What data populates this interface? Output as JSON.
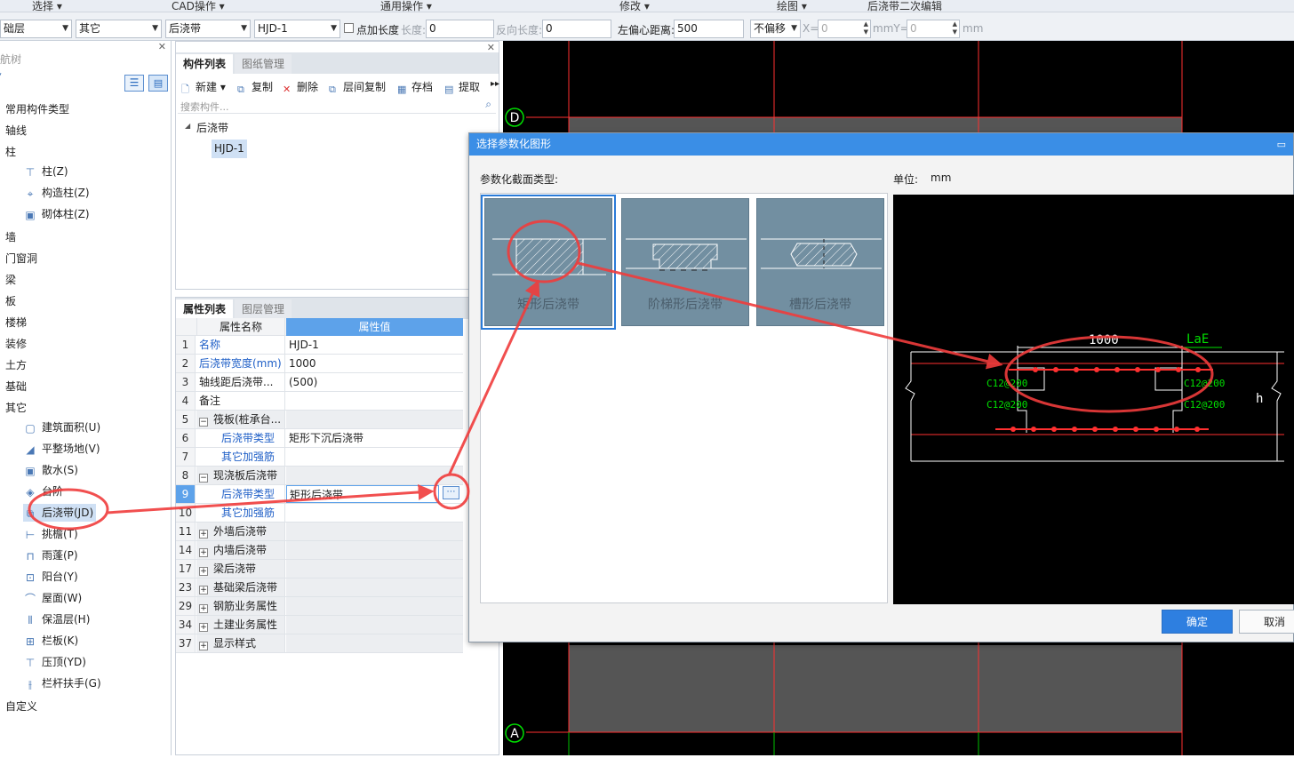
{
  "menubar": {
    "items": [
      "选择",
      "CAD操作",
      "通用操作",
      "修改",
      "绘图",
      "后浇带二次编辑"
    ]
  },
  "toolbar": {
    "floor": "础层",
    "category": "其它",
    "type": "后浇带",
    "element": "HJD-1",
    "checkbox_label": "点加长度",
    "length_label": "长度:",
    "length_value": "0",
    "reverse_label": "反向长度:",
    "reverse_value": "0",
    "offset_label": "左偏心距离:",
    "offset_value": "500",
    "mode": "不偏移",
    "x_label": "X=",
    "x_value": "0",
    "mmy_label": "mmY=",
    "y_value": "0",
    "mm_label": "mm"
  },
  "nav": {
    "title": "导航树",
    "items": [
      {
        "label": "常用构件类型"
      },
      {
        "label": "轴线"
      },
      {
        "label": "柱"
      },
      {
        "label": "柱(Z)",
        "sub": true,
        "icon": "column-icon"
      },
      {
        "label": "构造柱(Z)",
        "sub": true,
        "icon": "construct-column-icon"
      },
      {
        "label": "砌体柱(Z)",
        "sub": true,
        "icon": "masonry-column-icon"
      },
      {
        "label": "墙"
      },
      {
        "label": "门窗洞"
      },
      {
        "label": "梁"
      },
      {
        "label": "板"
      },
      {
        "label": "楼梯"
      },
      {
        "label": "装修"
      },
      {
        "label": "土方"
      },
      {
        "label": "基础"
      },
      {
        "label": "其它"
      },
      {
        "label": "建筑面积(U)",
        "sub": true,
        "icon": "area-icon"
      },
      {
        "label": "平整场地(V)",
        "sub": true,
        "icon": "site-icon"
      },
      {
        "label": "散水(S)",
        "sub": true,
        "icon": "apron-icon"
      },
      {
        "label": "台阶",
        "sub": true,
        "icon": "step-icon"
      },
      {
        "label": "后浇带(JD)",
        "sub": true,
        "icon": "post-pour-icon",
        "selected": true
      },
      {
        "label": "挑檐(T)",
        "sub": true,
        "icon": "eave-icon"
      },
      {
        "label": "雨蓬(P)",
        "sub": true,
        "icon": "canopy-icon"
      },
      {
        "label": "阳台(Y)",
        "sub": true,
        "icon": "balcony-icon"
      },
      {
        "label": "屋面(W)",
        "sub": true,
        "icon": "roof-icon"
      },
      {
        "label": "保温层(H)",
        "sub": true,
        "icon": "insulation-icon"
      },
      {
        "label": "栏板(K)",
        "sub": true,
        "icon": "parapet-icon"
      },
      {
        "label": "压顶(YD)",
        "sub": true,
        "icon": "coping-icon"
      },
      {
        "label": "栏杆扶手(G)",
        "sub": true,
        "icon": "railing-icon"
      },
      {
        "label": "自定义"
      }
    ]
  },
  "components": {
    "tabs": [
      "构件列表",
      "图纸管理"
    ],
    "buttons": [
      "新建",
      "复制",
      "删除",
      "层间复制",
      "存档",
      "提取"
    ],
    "search_placeholder": "搜索构件...",
    "tree_root": "后浇带",
    "tree_child": "HJD-1"
  },
  "properties": {
    "tabs": [
      "属性列表",
      "图层管理"
    ],
    "col_name": "属性名称",
    "col_value": "属性值",
    "rows": [
      {
        "num": "1",
        "name": "名称",
        "value": "HJD-1",
        "blue": true
      },
      {
        "num": "2",
        "name": "后浇带宽度(mm)",
        "value": "1000",
        "blue": true
      },
      {
        "num": "3",
        "name": "轴线距后浇带...",
        "value": "(500)"
      },
      {
        "num": "4",
        "name": "备注",
        "value": ""
      },
      {
        "num": "5",
        "name": "筏板(桩承台...",
        "value": "",
        "group": "minus"
      },
      {
        "num": "6",
        "name": "后浇带类型",
        "value": "矩形下沉后浇带",
        "blue": true,
        "indent": true
      },
      {
        "num": "7",
        "name": "其它加强筋",
        "value": "",
        "blue": true,
        "indent": true
      },
      {
        "num": "8",
        "name": "现浇板后浇带",
        "value": "",
        "group": "minus"
      },
      {
        "num": "9",
        "name": "后浇带类型",
        "value": "矩形后浇带",
        "blue": true,
        "indent": true,
        "active": true
      },
      {
        "num": "10",
        "name": "其它加强筋",
        "value": "",
        "blue": true,
        "indent": true
      },
      {
        "num": "11",
        "name": "外墙后浇带",
        "value": "",
        "group": "plus"
      },
      {
        "num": "14",
        "name": "内墙后浇带",
        "value": "",
        "group": "plus"
      },
      {
        "num": "17",
        "name": "梁后浇带",
        "value": "",
        "group": "plus"
      },
      {
        "num": "23",
        "name": "基础梁后浇带",
        "value": "",
        "group": "plus"
      },
      {
        "num": "29",
        "name": "钢筋业务属性",
        "value": "",
        "group": "plus"
      },
      {
        "num": "34",
        "name": "土建业务属性",
        "value": "",
        "group": "plus"
      },
      {
        "num": "37",
        "name": "显示样式",
        "value": "",
        "group": "plus"
      }
    ]
  },
  "canvas": {
    "axis_d": "D",
    "axis_a": "A"
  },
  "dialog": {
    "title": "选择参数化图形",
    "section_label": "参数化截面类型:",
    "unit_label": "单位:",
    "unit_value": "mm",
    "shapes": [
      "矩形后浇带",
      "阶梯形后浇带",
      "槽形后浇带"
    ],
    "preview": {
      "dim": "1000",
      "lae": "LaE",
      "h": "h",
      "rebar": "C12@200"
    },
    "ok": "确定",
    "cancel": "取消"
  },
  "colors": {
    "accent": "#2e7fe0",
    "annotation": "#f03c3c",
    "cad_green": "#00e000",
    "cad_red": "#ff3030"
  }
}
